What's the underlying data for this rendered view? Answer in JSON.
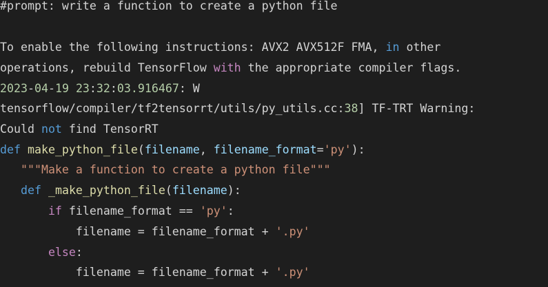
{
  "colors": {
    "background": "#1e1e1e",
    "text": "#d4d4d4",
    "keyword": "#569cd6",
    "control": "#c586c0",
    "string": "#ce9178",
    "number": "#b5cea8",
    "function": "#dcdcaa",
    "parameter": "#9cdcfe"
  },
  "lines": [
    {
      "tokens": [
        {
          "text": "#prompt: write a function to create a python file",
          "kind": "plain"
        }
      ]
    },
    {
      "tokens": [
        {
          "text": "To enable the following instructions: AVX2 AVX512F FMA, ",
          "kind": "plain"
        },
        {
          "text": "in",
          "kind": "kw"
        },
        {
          "text": " other",
          "kind": "plain"
        }
      ]
    },
    {
      "tokens": [
        {
          "text": "operations, rebuild TensorFlow ",
          "kind": "plain"
        },
        {
          "text": "with",
          "kind": "ctrl"
        },
        {
          "text": " the appropriate compiler flags.",
          "kind": "plain"
        }
      ]
    },
    {
      "tokens": [
        {
          "text": "2023",
          "kind": "num"
        },
        {
          "text": "-",
          "kind": "plain"
        },
        {
          "text": "04",
          "kind": "num"
        },
        {
          "text": "-",
          "kind": "plain"
        },
        {
          "text": "19",
          "kind": "num"
        },
        {
          "text": " ",
          "kind": "plain"
        },
        {
          "text": "23",
          "kind": "num"
        },
        {
          "text": ":",
          "kind": "plain"
        },
        {
          "text": "32",
          "kind": "num"
        },
        {
          "text": ":",
          "kind": "plain"
        },
        {
          "text": "03.916467",
          "kind": "num"
        },
        {
          "text": ": W",
          "kind": "plain"
        }
      ]
    },
    {
      "tokens": [
        {
          "text": "tensorflow/compiler/tf2tensorrt/utils/py_utils.cc:",
          "kind": "plain"
        },
        {
          "text": "38",
          "kind": "num"
        },
        {
          "text": "] TF-TRT Warning:",
          "kind": "plain"
        }
      ]
    },
    {
      "tokens": [
        {
          "text": "Could ",
          "kind": "plain"
        },
        {
          "text": "not",
          "kind": "kw"
        },
        {
          "text": " find TensorRT",
          "kind": "plain"
        }
      ]
    },
    {
      "tokens": [
        {
          "text": "def",
          "kind": "kw"
        },
        {
          "text": " ",
          "kind": "plain"
        },
        {
          "text": "make_python_file",
          "kind": "fn"
        },
        {
          "text": "(",
          "kind": "plain"
        },
        {
          "text": "filename",
          "kind": "param"
        },
        {
          "text": ", ",
          "kind": "plain"
        },
        {
          "text": "filename_format",
          "kind": "param"
        },
        {
          "text": "=",
          "kind": "plain"
        },
        {
          "text": "'py'",
          "kind": "str"
        },
        {
          "text": "):",
          "kind": "plain"
        }
      ]
    },
    {
      "tokens": [
        {
          "text": "   ",
          "kind": "plain"
        },
        {
          "text": "\"\"\"Make a function to create a python file\"\"\"",
          "kind": "str"
        }
      ]
    },
    {
      "tokens": [
        {
          "text": "   ",
          "kind": "plain"
        },
        {
          "text": "def",
          "kind": "kw"
        },
        {
          "text": " ",
          "kind": "plain"
        },
        {
          "text": "_make_python_file",
          "kind": "fn"
        },
        {
          "text": "(",
          "kind": "plain"
        },
        {
          "text": "filename",
          "kind": "param"
        },
        {
          "text": "):",
          "kind": "plain"
        }
      ]
    },
    {
      "tokens": [
        {
          "text": "       ",
          "kind": "plain"
        },
        {
          "text": "if",
          "kind": "ctrl"
        },
        {
          "text": " filename_format == ",
          "kind": "plain"
        },
        {
          "text": "'py'",
          "kind": "str"
        },
        {
          "text": ":",
          "kind": "plain"
        }
      ]
    },
    {
      "tokens": [
        {
          "text": "           filename = filename_format + ",
          "kind": "plain"
        },
        {
          "text": "'.py'",
          "kind": "str"
        }
      ]
    },
    {
      "tokens": [
        {
          "text": "       ",
          "kind": "plain"
        },
        {
          "text": "else",
          "kind": "ctrl"
        },
        {
          "text": ":",
          "kind": "plain"
        }
      ]
    },
    {
      "tokens": [
        {
          "text": "           filename = filename_format + ",
          "kind": "plain"
        },
        {
          "text": "'.py'",
          "kind": "str"
        }
      ]
    }
  ]
}
